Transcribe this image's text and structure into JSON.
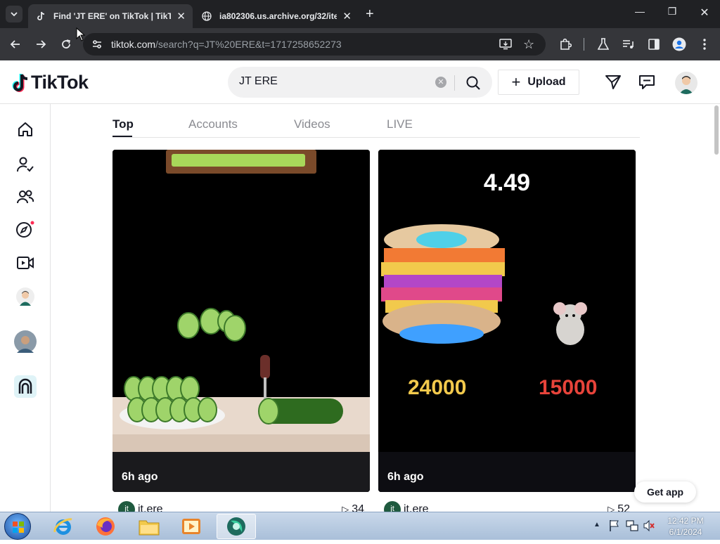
{
  "browser": {
    "tabs": [
      {
        "title": "Find 'JT ERE' on TikTok | TikTok",
        "active": true
      },
      {
        "title": "ia802306.us.archive.org/32/ite",
        "active": false
      }
    ],
    "url_host": "tiktok.com",
    "url_path": "/search?q=JT%20ERE&t=1717258652273"
  },
  "header": {
    "logo_text": "TikTok",
    "search_value": "JT ERE",
    "upload_label": "Upload"
  },
  "content_tabs": [
    "Top",
    "Accounts",
    "Videos",
    "LIVE"
  ],
  "videos": [
    {
      "time": "6h ago",
      "author_initials": "jt",
      "author": "jt.ere",
      "plays": "34"
    },
    {
      "time": "6h ago",
      "author_initials": "jt",
      "author": "jt.ere",
      "plays": "52",
      "overlay_top": "4.49",
      "score_left": "24000",
      "score_right": "15000"
    }
  ],
  "get_app_label": "Get app",
  "taskbar": {
    "time": "12:42 PM",
    "date": "6/1/2024"
  },
  "colors": {
    "tiktok_red": "#fe2c55",
    "tiktok_cyan": "#25f4ee",
    "dark": "#161823"
  }
}
